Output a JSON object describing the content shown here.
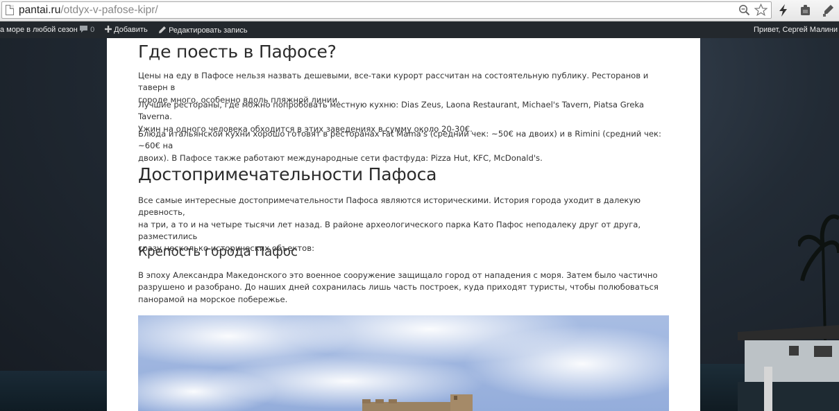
{
  "browser": {
    "url_host": "pantai.ru",
    "url_path": "/otdyx-v-pafose-kipr/"
  },
  "adminbar": {
    "site_link": "а море в любой сезон",
    "comments_count": "0",
    "add_new": "Добавить",
    "edit_post": "Редактировать запись",
    "greeting": "Привет, Сергей Малини"
  },
  "article": {
    "food": {
      "heading": "Где поесть в Пафосе?",
      "paragraphs": [
        [
          "Цены на еду в Пафосе нельзя назвать дешевыми, все-таки курорт рассчитан на состоятельную публику. Ресторанов и таверн в",
          "городе много, особенно вдоль пляжной линии."
        ],
        [
          "Лучшие рестораны, где можно попробовать местную кухню: Dias Zeus, Laona Restaurant, Michael's Tavern, Piatsa Greka Taverna.",
          "Ужин на одного человека обходится в этих заведениях в сумму около 20-30€."
        ],
        [
          "Блюда итальянской кухни хорошо готовят в ресторанах Fat Mama's (средний чек: ~50€ на двоих) и в Rimini (средний чек: ~60€ на",
          "двоих). В Пафосе также работают международные сети фастфуда: Pizza Hut, KFC, McDonald's."
        ]
      ]
    },
    "sights": {
      "heading": "Достопримечательности Пафоса",
      "paragraph": [
        "Все самые интересные достопримечательности Пафоса являются историческими. История города уходит в далекую древность,",
        "на три, а то и на четыре тысячи лет назад. В районе археологического парка Като Пафос неподалеку друг от друга, разместились",
        "сразу несколько исторических объектов:"
      ]
    },
    "fortress": {
      "heading": "Крепость города Пафос",
      "paragraph": [
        "В эпоху Александра Македонского это военное сооружение защищало город от нападения с моря. Затем было частично",
        "разрушено и разобрано. До наших дней сохранилась лишь часть построек, куда приходят туристы, чтобы полюбоваться",
        "панорамой на морское побережье."
      ]
    }
  },
  "colors": {
    "adminbar_bg": "#23282d",
    "text": "#333333",
    "heading": "#2b2b2b",
    "sky": "#9fb6de"
  }
}
